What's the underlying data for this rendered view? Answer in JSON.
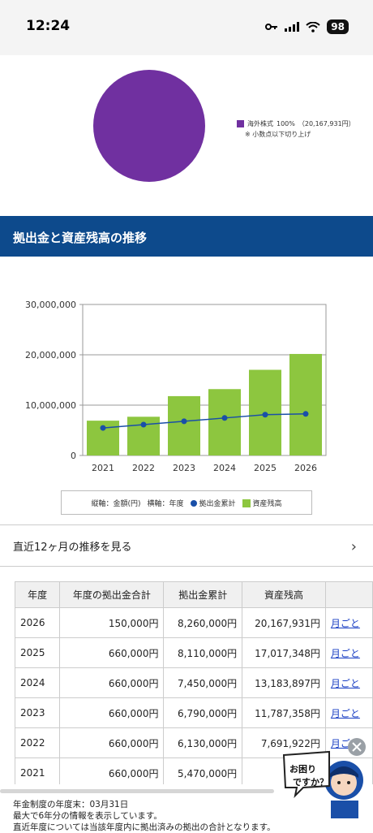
{
  "status_bar": {
    "time": "12:24",
    "battery": "98"
  },
  "allocation": {
    "items": [
      {
        "label": "海外株式",
        "percent": "100%",
        "amount": "（20,167,931円）",
        "color": "#7030a0"
      }
    ],
    "note": "※ 小数点以下切り上げ"
  },
  "section": {
    "title": "拠出金と資産残高の推移"
  },
  "chart_data": {
    "type": "bar",
    "categories": [
      "2021",
      "2022",
      "2023",
      "2024",
      "2025",
      "2026"
    ],
    "series": [
      {
        "name": "資産残高",
        "type": "bar",
        "color": "#8dc63f",
        "values": [
          6913000,
          7691922,
          11787358,
          13183897,
          17017348,
          20167931
        ]
      },
      {
        "name": "拠出金累計",
        "type": "line",
        "color": "#1a4fa8",
        "values": [
          5470000,
          6130000,
          6790000,
          7450000,
          8110000,
          8260000
        ]
      }
    ],
    "yticks": [
      "0",
      "10,000,000",
      "20,000,000",
      "30,000,000"
    ],
    "ylim": [
      0,
      30000000
    ],
    "legend_labels": {
      "vertical": "縦軸：金額(円)",
      "horizontal": "横軸：年度",
      "line": "拠出金累計",
      "bar": "資産残高"
    }
  },
  "link_row": {
    "label": "直近12ヶ月の推移を見る"
  },
  "table": {
    "headers": [
      "年度",
      "年度の拠出金合計",
      "拠出金累計",
      "資産残高",
      ""
    ],
    "rows": [
      [
        "2026",
        "150,000円",
        "8,260,000円",
        "20,167,931円",
        "月ごと"
      ],
      [
        "2025",
        "660,000円",
        "8,110,000円",
        "17,017,348円",
        "月ごと"
      ],
      [
        "2024",
        "660,000円",
        "7,450,000円",
        "13,183,897円",
        "月ごと"
      ],
      [
        "2023",
        "660,000円",
        "6,790,000円",
        "11,787,358円",
        "月ごと"
      ],
      [
        "2022",
        "660,000円",
        "6,130,000円",
        "7,691,922円",
        "月ごと"
      ],
      [
        "2021",
        "660,000円",
        "5,470,000円",
        "6,91",
        "月ごと"
      ]
    ]
  },
  "footer": {
    "line1": "年金制度の年度末：03月31日",
    "line2": "最大で6年分の情報を表示しています。",
    "line3": "直近年度については当該年度内に拠出済みの拠出の合計となります。"
  },
  "helper": {
    "bubble_line1": "お困り",
    "bubble_line2": "ですか？"
  }
}
